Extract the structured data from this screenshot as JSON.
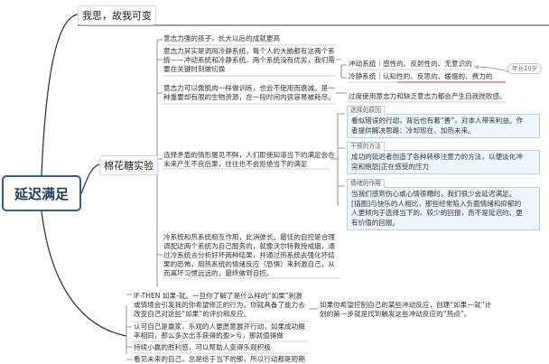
{
  "root": {
    "label": "延迟满足"
  },
  "topics": {
    "top": "我思，故我可变",
    "mid": "棉花糖实验"
  },
  "upper_notes": [
    "意志力强的孩子，长大以后的成就更高",
    "意志力其实是调用冷静系统，每个人的大脑都有这两个系",
    "统——冲动系统和冷静系统。两个系统没有优劣，我们需",
    "要在关键时刻做切换",
    "意志力可以像肌肉一样做训练，也会不使用而衰减。是一",
    "种重要却有限的生物资源，在一段时间内很容易被耗尽。"
  ],
  "systems": {
    "impulsive": "冲动系统｜感性的、反射性的、无意识的",
    "calm": "冷静系统｜认知性的、反思的、缓慢的、费力的",
    "age_tag": "年长10岁",
    "overuse": "过度使用意志力和缺乏意志力都会产生自我挫败感。"
  },
  "marshmallow": {
    "choice_note": [
      "选择矛盾的情形屡见不鲜，人们即使知道当下的满足会在",
      "未来产生不良后果，往往也不会拒绝当下的满足"
    ],
    "boxes": [
      {
        "header": "选择的原因",
        "lines": [
          "看似错误的行动，背后也有着“善”，对本人带来利益。作",
          "者提供解决思路：冷却现在、加热未来。"
        ]
      },
      {
        "header": "干预的方法",
        "lines": [
          "成功的延迟者创造了各种转移注意力的方法，以便淡化冲",
          "突和抱怨|正在感受的压力"
        ]
      },
      {
        "header": "情绪的作用",
        "lines": [
          "当我们感到伤心或心情很糟时，我们很少会延迟满足。",
          "[插图]与快乐的人相比，那些经常陷入负面情绪和抑郁的",
          "人更倾向于选择当下的、较少的回报，而不是延迟的、更",
          "有价值的回报。"
        ]
      }
    ],
    "cold_hot": [
      "冷系统和热系统相互作用，此消彼长。最佳的自控是合理",
      "调配这两个系统为自己服务的，就像沃尔特教授戒烟，通",
      "过冷系统去分析好坏两种结果，并通过热系统去强化坏结",
      "果的恐怖，用热系统的情绪反应（恐惧）来刺激自己，从",
      "而离坏习惯远远的，最终做到自控。"
    ]
  },
  "if_then": {
    "left": [
      "IF-THEN 如果-就。一旦你了解了是什么样的“如果”刺激",
      "或情境会引发我的你希望修正的行为，你就具备了能力去",
      "改变自己对这些“如果”的评价和反应。"
    ],
    "right": [
      "如果你希望控制自己的某些冲动反应，创建“如果—就”计",
      "划的第一步就是找到触发这些冲动反应的“热点”。"
    ]
  },
  "bottom_notes": [
    "认可自己是赢家，乐观的人更愿意展开行动，如果成功概",
    "率相同，那么多次出手获得的盈>亏，那就值得做",
    "持续小赢的胜利感，可以帮助人变得乐观积极",
    "看见未来的自己，总是给于当下的那，所以行动都是短期"
  ],
  "colors": {
    "root_border": "#2f5e8f",
    "branch": "#3a3a3a",
    "box_fill": "#eef5fb",
    "box_border": "#b5cfe3",
    "accent_red": "#c0392b"
  }
}
